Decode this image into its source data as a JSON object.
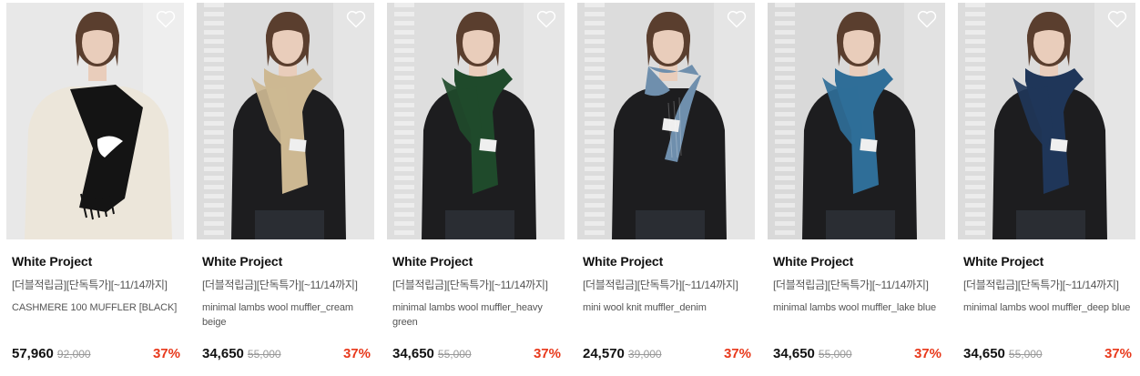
{
  "products": [
    {
      "brand": "White Project",
      "promo": "[더블적립금][단독특가][~11/14까지]",
      "name": "CASHMERE 100 MUFFLER [BLACK]",
      "price": "57,960",
      "original_price": "92,000",
      "discount": "37%",
      "scarf_color": "#141414",
      "top_color": "#ece6da",
      "bg_color": "#e8e8e8",
      "scarf_style": "cashmere"
    },
    {
      "brand": "White Project",
      "promo": "[더블적립금][단독특가][~11/14까지]",
      "name": "minimal lambs wool muffler_cream beige",
      "price": "34,650",
      "original_price": "55,000",
      "discount": "37%",
      "scarf_color": "#cdb892",
      "top_color": "#1d1d1f",
      "bg_color": "#dcdcdc",
      "scarf_style": "wrap"
    },
    {
      "brand": "White Project",
      "promo": "[더블적립금][단독특가][~11/14까지]",
      "name": "minimal lambs wool muffler_heavy green",
      "price": "34,650",
      "original_price": "55,000",
      "discount": "37%",
      "scarf_color": "#1f4a2b",
      "top_color": "#1d1d1f",
      "bg_color": "#dedede",
      "scarf_style": "wrap"
    },
    {
      "brand": "White Project",
      "promo": "[더블적립금][단독특가][~11/14까지]",
      "name": "mini wool knit muffler_denim",
      "price": "24,570",
      "original_price": "39,000",
      "discount": "37%",
      "scarf_color": "#6f8fad",
      "top_color": "#1d1d1f",
      "bg_color": "#dcdcdc",
      "scarf_style": "knit"
    },
    {
      "brand": "White Project",
      "promo": "[더블적립금][단독특가][~11/14까지]",
      "name": "minimal lambs wool muffler_lake blue",
      "price": "34,650",
      "original_price": "55,000",
      "discount": "37%",
      "scarf_color": "#2f6e98",
      "top_color": "#1d1d1f",
      "bg_color": "#d9d9d9",
      "scarf_style": "wrap"
    },
    {
      "brand": "White Project",
      "promo": "[더블적립금][단독특가][~11/14까지]",
      "name": "minimal lambs wool muffler_deep blue",
      "price": "34,650",
      "original_price": "55,000",
      "discount": "37%",
      "scarf_color": "#1f3659",
      "top_color": "#1d1d1f",
      "bg_color": "#dcdcdc",
      "scarf_style": "wrap"
    }
  ],
  "colors": {
    "discount": "#e8391c",
    "price": "#111111",
    "original_price": "#999999",
    "heart_outline": "#ffffff"
  },
  "icons": {
    "wishlist": "heart-outline-icon"
  }
}
